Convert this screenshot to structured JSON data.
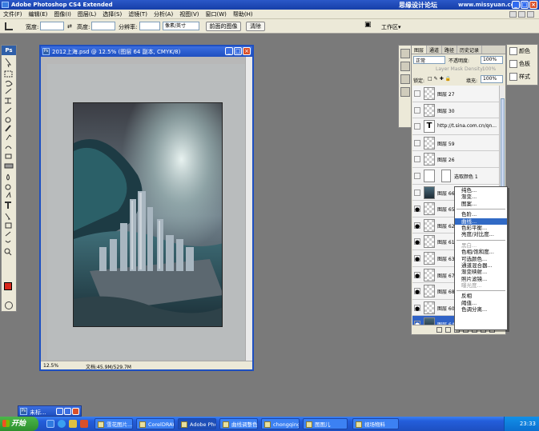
{
  "app": {
    "title": "Adobe Photoshop CS4 Extended",
    "watermark": "思缘设计论坛",
    "watermark_url": "www.missyuan.com"
  },
  "menu": [
    "文件(F)",
    "编辑(E)",
    "图像(I)",
    "图层(L)",
    "选择(S)",
    "滤镜(T)",
    "分析(A)",
    "视图(V)",
    "窗口(W)",
    "帮助(H)"
  ],
  "options": {
    "width_label": "宽度:",
    "height_label": "高度:",
    "resolution_label": "分辨率:",
    "unit_value": "像素/英寸",
    "front_image_button": "前面的图像",
    "clear_button": "清除",
    "workspace_label": "工作区▾"
  },
  "document": {
    "title": "2012上海.psd @ 12.5% (图层 64 副本, CMYK/8)",
    "zoom": "12.5%",
    "doc_size": "文档:45.9M/529.7M"
  },
  "layers_panel": {
    "tabs": [
      "图层",
      "通道",
      "路径",
      "历史记录"
    ],
    "blend_mode": "正常",
    "opacity_label": "不透明度:",
    "opacity_value": "100%",
    "mask_density_label": "Layer Mask Density:",
    "mask_density_value": "100%",
    "lock_label": "锁定:",
    "fill_label": "填充:",
    "fill_value": "100%",
    "layers": [
      {
        "name": "图层 27",
        "thumb": "checker",
        "eye": false,
        "selected": false
      },
      {
        "name": "图层 30",
        "thumb": "checker",
        "eye": false,
        "selected": false
      },
      {
        "name": "http://t.sina.com.cn/qn...",
        "thumb": "text",
        "eye": false,
        "selected": false
      },
      {
        "name": "图层 59",
        "thumb": "checker",
        "eye": false,
        "selected": false
      },
      {
        "name": "图层 26",
        "thumb": "checker",
        "eye": false,
        "selected": false
      },
      {
        "name": "选取颜色 1",
        "thumb": "adjust",
        "eye": false,
        "selected": false
      },
      {
        "name": "图层 66",
        "thumb": "dark",
        "eye": false,
        "selected": false
      },
      {
        "name": "图层 65",
        "thumb": "checker",
        "eye": true,
        "selected": false
      },
      {
        "name": "图层 62",
        "thumb": "checker",
        "eye": true,
        "selected": false
      },
      {
        "name": "图层 61",
        "thumb": "checker",
        "eye": true,
        "selected": false
      },
      {
        "name": "图层 63",
        "thumb": "checker",
        "eye": true,
        "selected": false
      },
      {
        "name": "图层 67",
        "thumb": "checker",
        "eye": true,
        "selected": false
      },
      {
        "name": "图层 68",
        "thumb": "checker",
        "eye": true,
        "selected": false
      },
      {
        "name": "图层 60",
        "thumb": "checker",
        "eye": true,
        "selected": false
      },
      {
        "name": "图层 64...",
        "thumb": "dark",
        "eye": true,
        "selected": true
      }
    ]
  },
  "right_panel": [
    "颜色",
    "色板",
    "样式"
  ],
  "context_menu": {
    "groups": [
      [
        {
          "label": "纯色...",
          "state": "normal"
        },
        {
          "label": "渐变...",
          "state": "normal"
        },
        {
          "label": "图案...",
          "state": "normal"
        }
      ],
      [
        {
          "label": "色阶...",
          "state": "normal"
        },
        {
          "label": "曲线...",
          "state": "selected"
        },
        {
          "label": "色彩平衡...",
          "state": "normal"
        },
        {
          "label": "亮度/对比度...",
          "state": "normal"
        }
      ],
      [
        {
          "label": "黑白...",
          "state": "disabled"
        },
        {
          "label": "色相/饱和度...",
          "state": "normal"
        },
        {
          "label": "可选颜色...",
          "state": "normal"
        },
        {
          "label": "通道混合器...",
          "state": "normal"
        },
        {
          "label": "渐变映射...",
          "state": "normal"
        },
        {
          "label": "照片滤镜...",
          "state": "normal"
        },
        {
          "label": "曝光度...",
          "state": "disabled"
        }
      ],
      [
        {
          "label": "反相",
          "state": "normal"
        },
        {
          "label": "阈值...",
          "state": "normal"
        },
        {
          "label": "色调分离...",
          "state": "normal"
        }
      ]
    ]
  },
  "minimized_doc": {
    "label": "未标..."
  },
  "taskbar": {
    "start_label": "开始",
    "tasks": [
      "雪花图片...",
      "CorelDRAW",
      "Adobe Phot...",
      "曲线调整色...",
      "chongqing",
      "图图儿",
      "视场物料"
    ],
    "clock": "23:33"
  }
}
